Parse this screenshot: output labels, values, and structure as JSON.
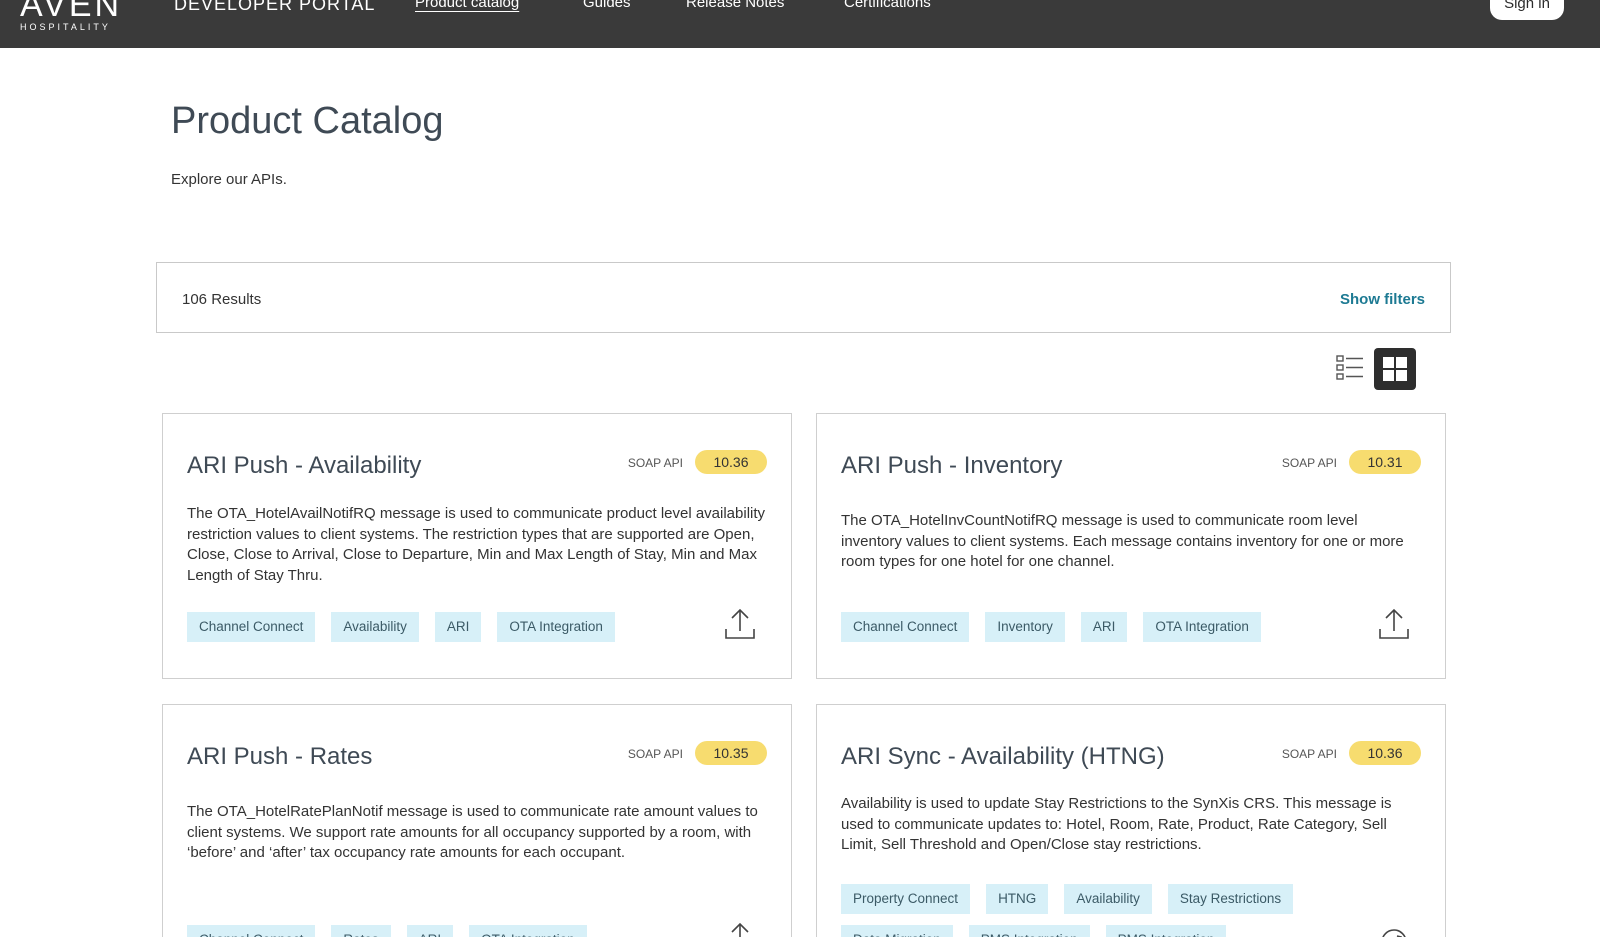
{
  "header": {
    "logo_main": "AVEN",
    "logo_sub": "HOSPITALITY",
    "portal_title": "DEVELOPER PORTAL",
    "nav": [
      {
        "label": "Product catalog"
      },
      {
        "label": "Guides"
      },
      {
        "label": "Release Notes"
      },
      {
        "label": "Certifications"
      }
    ],
    "signin_label": "Sign in"
  },
  "page": {
    "title": "Product Catalog",
    "subtitle": "Explore our APIs."
  },
  "results": {
    "count_label": "106 Results",
    "filters_label": "Show filters"
  },
  "view_toggle": {
    "active": "grid"
  },
  "cards": [
    {
      "title": "ARI Push - Availability",
      "type": "SOAP API",
      "version": "10.36",
      "description": "The OTA_HotelAvailNotifRQ message is used to communicate product level availability restriction values to client systems. The restriction types that are supported are Open, Close, Close to Arrival, Close to Departure, Min and Max Length of Stay, Min and Max Length of Stay Thru.",
      "tags": [
        "Channel Connect",
        "Availability",
        "ARI",
        "OTA Integration"
      ],
      "icon": "upload-icon"
    },
    {
      "title": "ARI Push - Inventory",
      "type": "SOAP API",
      "version": "10.31",
      "description": "The OTA_HotelInvCountNotifRQ message is used to communicate room level inventory values to client systems. Each message contains inventory for one or more room types for one hotel for one channel.",
      "tags": [
        "Channel Connect",
        "Inventory",
        "ARI",
        "OTA Integration"
      ],
      "icon": "upload-icon"
    },
    {
      "title": "ARI Push - Rates",
      "type": "SOAP API",
      "version": "10.35",
      "description": "The OTA_HotelRatePlanNotif message is used to communicate rate amount values to client systems. We support rate amounts for all occupancy supported by a room, with ‘before’ and ‘after’ tax occupancy rate amounts for each occupant.",
      "tags": [
        "Channel Connect",
        "Rates",
        "ARI",
        "OTA Integration"
      ],
      "icon": "upload-icon"
    },
    {
      "title": "ARI Sync - Availability (HTNG)",
      "type": "SOAP API",
      "version": "10.36",
      "description": "Availability is used to update Stay Restrictions to the SynXis CRS. This message is used to communicate updates to: Hotel, Room, Rate, Product, Rate Category, Sell Limit, Sell Threshold and Open/Close stay restrictions.",
      "tags": [
        "Property Connect",
        "HTNG",
        "Availability",
        "Stay Restrictions"
      ],
      "tags_row2": [
        "Data Migration",
        "PMS Integration",
        "PMS Integration"
      ],
      "icon": "sync-icon"
    }
  ]
}
